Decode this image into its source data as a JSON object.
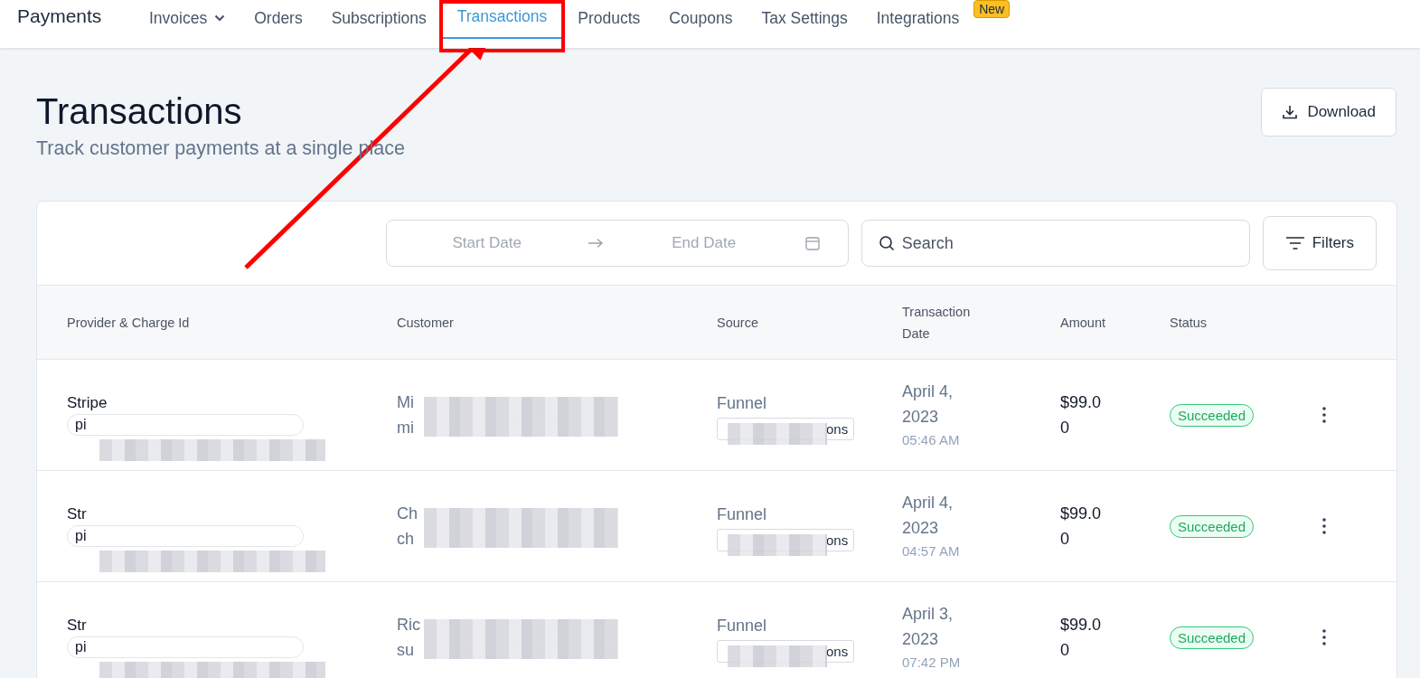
{
  "app_title": "Payments",
  "nav": [
    {
      "label": "Invoices",
      "dropdown": true,
      "selected": false
    },
    {
      "label": "Orders",
      "dropdown": false,
      "selected": false
    },
    {
      "label": "Subscriptions",
      "dropdown": false,
      "selected": false
    },
    {
      "label": "Transactions",
      "dropdown": false,
      "selected": true,
      "highlighted": true
    },
    {
      "label": "Products",
      "dropdown": false,
      "selected": false
    },
    {
      "label": "Coupons",
      "dropdown": false,
      "selected": false
    },
    {
      "label": "Tax Settings",
      "dropdown": false,
      "selected": false
    },
    {
      "label": "Integrations",
      "dropdown": false,
      "selected": false,
      "badge": "New"
    }
  ],
  "page": {
    "title": "Transactions",
    "subtitle": "Track customer payments at a single place",
    "download_button": "Download"
  },
  "toolbar": {
    "start_placeholder": "Start Date",
    "end_placeholder": "End Date",
    "search_placeholder": "Search",
    "filters_button": "Filters"
  },
  "table": {
    "columns": [
      "Provider & Charge Id",
      "Customer",
      "Source",
      "Transaction Date",
      "Amount",
      "Status"
    ],
    "rows": [
      {
        "provider": "Stripe",
        "charge_id": "pi",
        "customer_name": "Mi",
        "customer_email": "mi",
        "source": "Funnel",
        "source_tag": "ons",
        "date": "April 4, 2023",
        "time": "05:46 AM",
        "amount": "$99.00",
        "status": "Succeeded"
      },
      {
        "provider": "Str",
        "charge_id": "pi",
        "customer_name": "Ch",
        "customer_email": "ch",
        "source": "Funnel",
        "source_tag": "ons",
        "date": "April 4, 2023",
        "time": "04:57 AM",
        "amount": "$99.00",
        "status": "Succeeded"
      },
      {
        "provider": "Str",
        "charge_id": "pi",
        "customer_name": "Ric",
        "customer_email": "su",
        "source": "Funnel",
        "source_tag": "ons",
        "date": "April 3, 2023",
        "time": "07:42 PM",
        "amount": "$99.00",
        "status": "Succeeded"
      }
    ]
  }
}
